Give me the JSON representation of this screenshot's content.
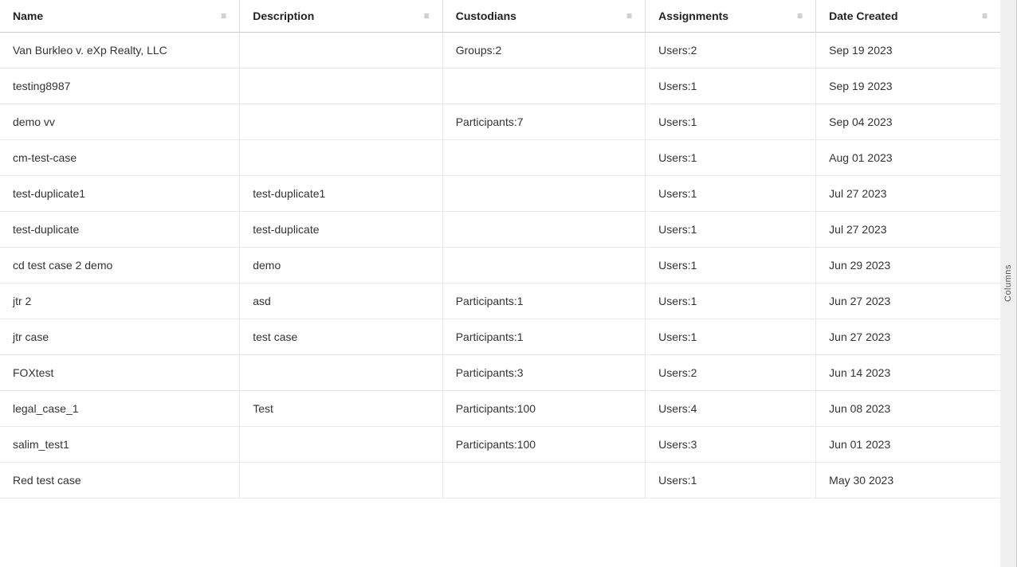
{
  "columns": [
    {
      "id": "name",
      "label": "Name",
      "class": "col-name"
    },
    {
      "id": "description",
      "label": "Description",
      "class": "col-desc"
    },
    {
      "id": "custodians",
      "label": "Custodians",
      "class": "col-custodians"
    },
    {
      "id": "assignments",
      "label": "Assignments",
      "class": "col-assignments"
    },
    {
      "id": "date_created",
      "label": "Date Created",
      "class": "col-date"
    }
  ],
  "rows": [
    {
      "name": "Van Burkleo v. eXp Realty, LLC",
      "description": "",
      "custodians": "Groups:2",
      "assignments": "Users:2",
      "date_created": "Sep 19 2023"
    },
    {
      "name": "testing8987",
      "description": "",
      "custodians": "",
      "assignments": "Users:1",
      "date_created": "Sep 19 2023"
    },
    {
      "name": "demo vv",
      "description": "",
      "custodians": "Participants:7",
      "assignments": "Users:1",
      "date_created": "Sep 04 2023"
    },
    {
      "name": "cm-test-case",
      "description": "",
      "custodians": "",
      "assignments": "Users:1",
      "date_created": "Aug 01 2023"
    },
    {
      "name": "test-duplicate1",
      "description": "test-duplicate1",
      "custodians": "",
      "assignments": "Users:1",
      "date_created": "Jul 27 2023"
    },
    {
      "name": "test-duplicate",
      "description": "test-duplicate",
      "custodians": "",
      "assignments": "Users:1",
      "date_created": "Jul 27 2023"
    },
    {
      "name": "cd test case 2 demo",
      "description": "demo",
      "custodians": "",
      "assignments": "Users:1",
      "date_created": "Jun 29 2023"
    },
    {
      "name": "jtr 2",
      "description": "asd",
      "custodians": "Participants:1",
      "assignments": "Users:1",
      "date_created": "Jun 27 2023"
    },
    {
      "name": "jtr case",
      "description": "test case",
      "custodians": "Participants:1",
      "assignments": "Users:1",
      "date_created": "Jun 27 2023"
    },
    {
      "name": "FOXtest",
      "description": "",
      "custodians": "Participants:3",
      "assignments": "Users:2",
      "date_created": "Jun 14 2023"
    },
    {
      "name": "legal_case_1",
      "description": "Test",
      "custodians": "Participants:100",
      "assignments": "Users:4",
      "date_created": "Jun 08 2023"
    },
    {
      "name": "salim_test1",
      "description": "",
      "custodians": "Participants:100",
      "assignments": "Users:3",
      "date_created": "Jun 01 2023"
    },
    {
      "name": "Red test case",
      "description": "",
      "custodians": "",
      "assignments": "Users:1",
      "date_created": "May 30 2023"
    }
  ],
  "side_label": "Columns",
  "menu_icon": "≡",
  "scroll_up": "▲",
  "scroll_down": "▼"
}
